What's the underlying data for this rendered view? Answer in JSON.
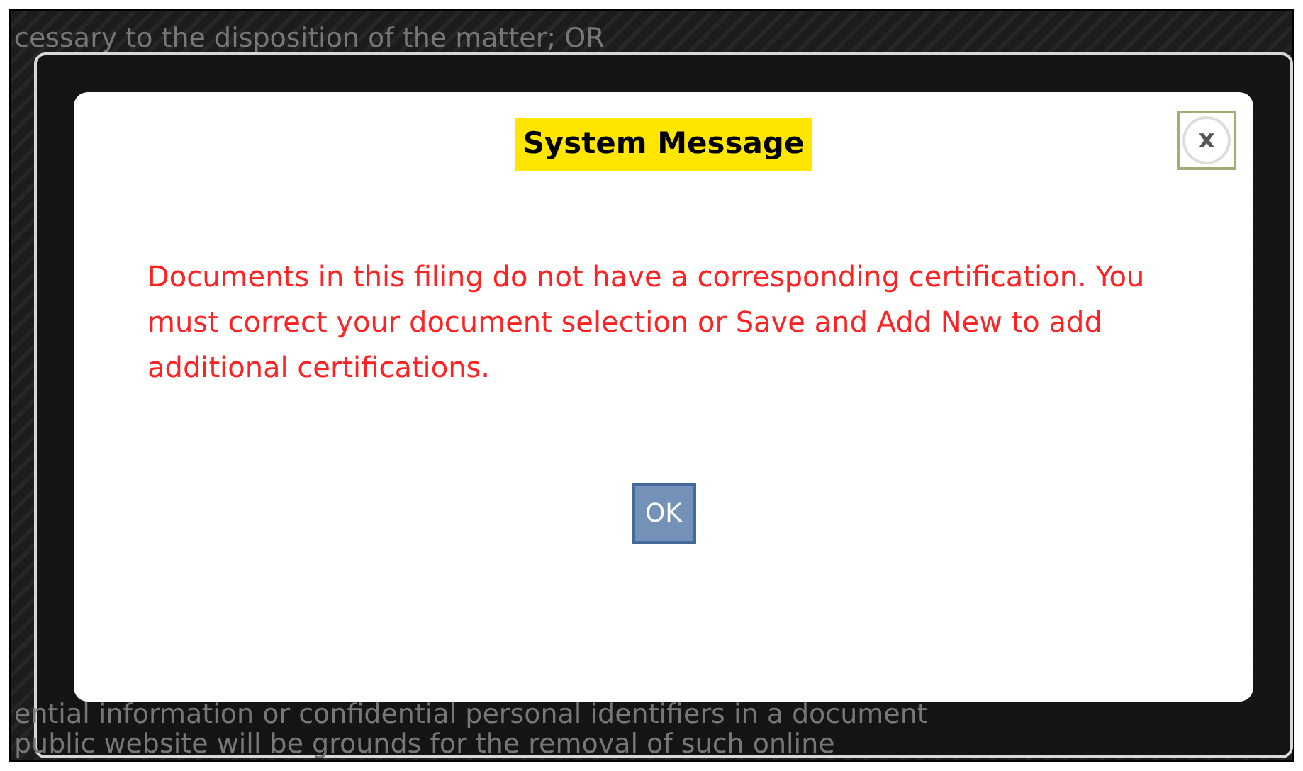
{
  "background_text": {
    "top_line": "cessary to the disposition of the matter; OR",
    "bottom_lines": [
      "ential information or confidential personal identifiers in a document",
      "public website will be grounds for the removal of such online"
    ]
  },
  "dialog": {
    "title": "System Message",
    "close_button": "x",
    "message": "Documents in this filing do not have a corresponding certification. You must correct your document selection or Save and Add New to add additional certifications.",
    "buttons": [
      "OK"
    ]
  }
}
